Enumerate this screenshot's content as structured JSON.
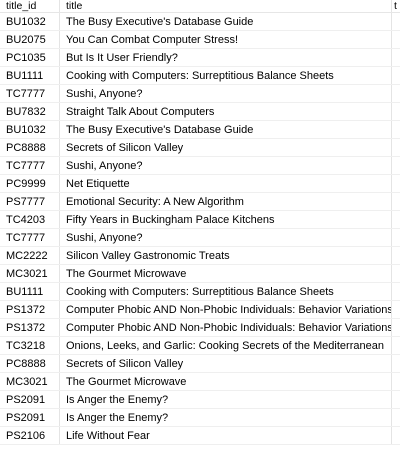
{
  "columns": [
    "title_id",
    "title",
    "t"
  ],
  "rows": [
    {
      "title_id": "BU1032",
      "title": "The Busy Executive's Database Guide"
    },
    {
      "title_id": "BU2075",
      "title": "You Can Combat Computer Stress!"
    },
    {
      "title_id": "PC1035",
      "title": "But Is It User Friendly?"
    },
    {
      "title_id": "BU1111",
      "title": "Cooking with Computers: Surreptitious Balance Sheets"
    },
    {
      "title_id": "TC7777",
      "title": "Sushi, Anyone?"
    },
    {
      "title_id": "BU7832",
      "title": "Straight Talk About Computers"
    },
    {
      "title_id": "BU1032",
      "title": "The Busy Executive's Database Guide"
    },
    {
      "title_id": "PC8888",
      "title": "Secrets of Silicon Valley"
    },
    {
      "title_id": "TC7777",
      "title": "Sushi, Anyone?"
    },
    {
      "title_id": "PC9999",
      "title": "Net Etiquette"
    },
    {
      "title_id": "PS7777",
      "title": "Emotional Security: A New Algorithm"
    },
    {
      "title_id": "TC4203",
      "title": "Fifty Years in Buckingham Palace Kitchens"
    },
    {
      "title_id": "TC7777",
      "title": "Sushi, Anyone?"
    },
    {
      "title_id": "MC2222",
      "title": "Silicon Valley Gastronomic Treats"
    },
    {
      "title_id": "MC3021",
      "title": "The Gourmet Microwave"
    },
    {
      "title_id": "BU1111",
      "title": "Cooking with Computers: Surreptitious Balance Sheets"
    },
    {
      "title_id": "PS1372",
      "title": "Computer Phobic AND Non-Phobic Individuals: Behavior Variations"
    },
    {
      "title_id": "PS1372",
      "title": "Computer Phobic AND Non-Phobic Individuals: Behavior Variations"
    },
    {
      "title_id": "TC3218",
      "title": "Onions, Leeks, and Garlic: Cooking Secrets of the Mediterranean"
    },
    {
      "title_id": "PC8888",
      "title": "Secrets of Silicon Valley"
    },
    {
      "title_id": "MC3021",
      "title": "The Gourmet Microwave"
    },
    {
      "title_id": "PS2091",
      "title": "Is Anger the Enemy?"
    },
    {
      "title_id": "PS2091",
      "title": "Is Anger the Enemy?"
    },
    {
      "title_id": "PS2106",
      "title": "Life Without Fear"
    }
  ]
}
